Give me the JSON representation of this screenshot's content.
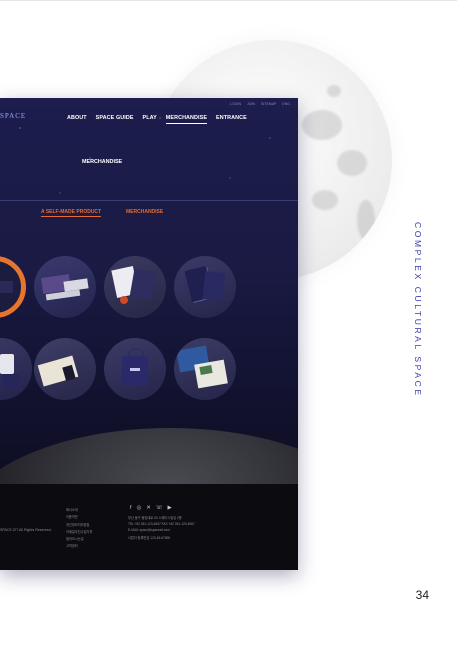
{
  "side_label": "COMPLEX CULTURAL SPACE",
  "page_number": "34",
  "site": {
    "logo": "SPACE",
    "util_links": [
      "LOGIN",
      "JOIN",
      "SITEMAP",
      "ENG"
    ],
    "nav": [
      {
        "label": "ABOUT",
        "active": false
      },
      {
        "label": "SPACE GUIDE",
        "active": false
      },
      {
        "label": "PLAY",
        "active": false
      },
      {
        "label": "MERCHANDISE",
        "active": true
      },
      {
        "label": "ENTRANCE",
        "active": false
      }
    ],
    "page_title": "MERCHANDISE",
    "subtabs": [
      {
        "label": "A SELF-MADE PRODUCT",
        "active": true
      },
      {
        "label": "MERCHANDISE",
        "active": false
      }
    ],
    "colors": {
      "accent": "#e86a2c",
      "bg": "#1b1b48",
      "moon_text": "#3a3aa8"
    },
    "footer": {
      "copyright": "SPACE.ZIT All Rights Reserved.",
      "links": [
        "회사소개",
        "이용약관",
        "개인정보처리방침",
        "이메일무단수집거부",
        "찾아오시는길",
        "고객센터"
      ],
      "social_icons": [
        "f",
        "◎",
        "✕",
        "☏",
        "▶"
      ],
      "contact": [
        "부산 동구 중앙대로 00 스페이스빌딩 2층",
        "TEL +82 051-123-4567  FAX +82 051-123-4567",
        "E-MAIL space@spacezit.com",
        "사업자 등록번호 123-45-67890"
      ]
    }
  }
}
